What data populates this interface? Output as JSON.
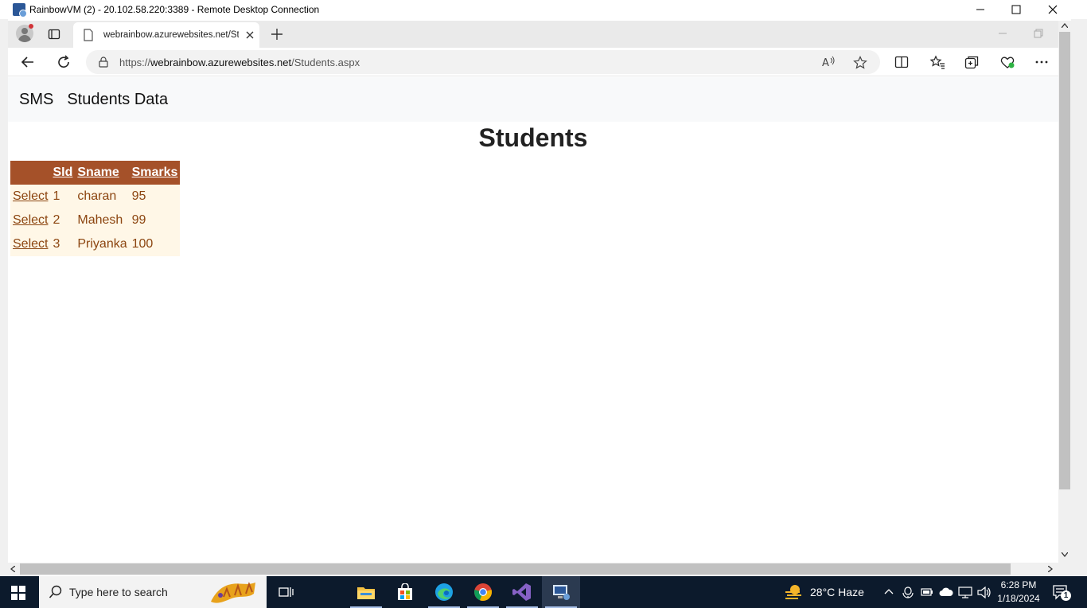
{
  "rdp": {
    "title": "RainbowVM (2) - 20.102.58.220:3389 - Remote Desktop Connection"
  },
  "browser": {
    "tab_title": "webrainbow.azurewebsites.net/Students.aspx",
    "url_prefix": "https://",
    "url_host": "webrainbow.azurewebsites.net",
    "url_path": "/Students.aspx"
  },
  "page": {
    "brand": "SMS",
    "nav_link": "Students Data",
    "heading": "Students",
    "table": {
      "columns": [
        "",
        "SId",
        "Sname",
        "Smarks"
      ],
      "select_label": "Select",
      "rows": [
        {
          "sid": "1",
          "sname": "charan",
          "smarks": "95"
        },
        {
          "sid": "2",
          "sname": "Mahesh",
          "smarks": "99"
        },
        {
          "sid": "3",
          "sname": "Priyanka",
          "smarks": "100"
        }
      ]
    },
    "colors": {
      "header_bg": "#A55129",
      "row_bg": "#FFF7E7",
      "row_text": "#8C4510"
    }
  },
  "taskbar": {
    "search_placeholder": "Type here to search",
    "weather": "28°C  Haze",
    "time": "6:28 PM",
    "date": "1/18/2024",
    "notification_count": "1"
  }
}
